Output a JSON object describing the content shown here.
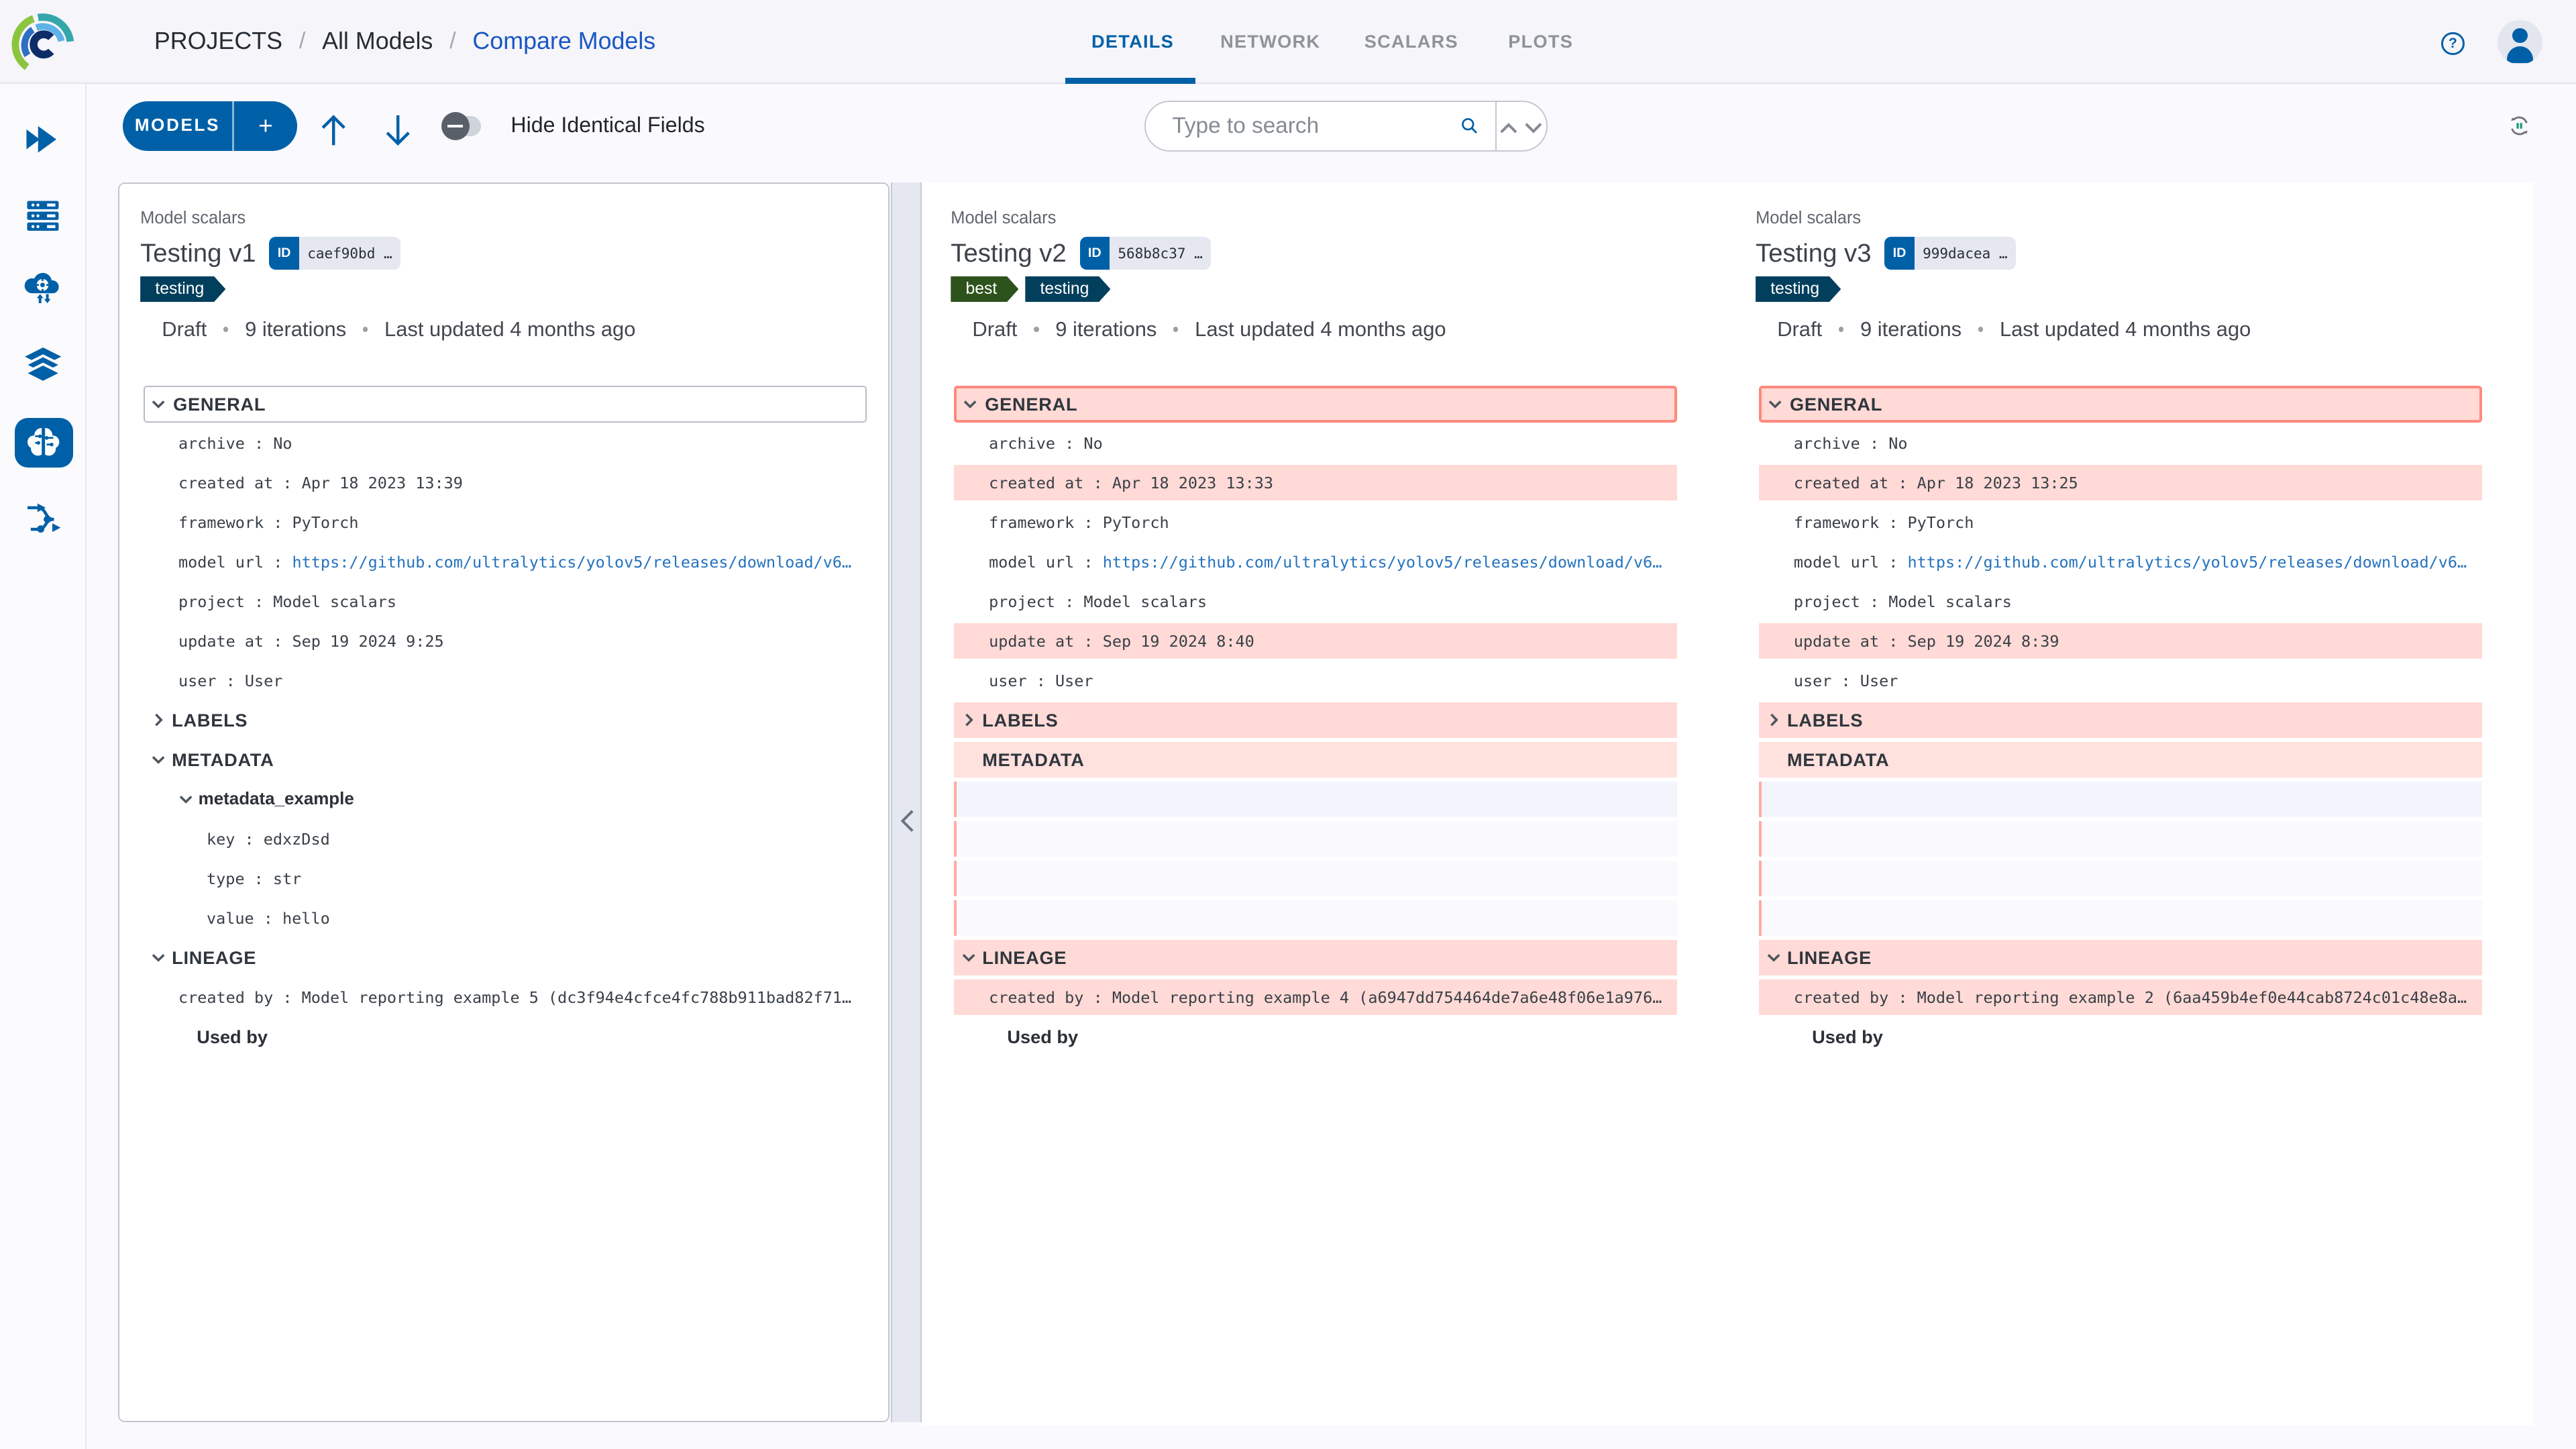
{
  "header": {
    "breadcrumbs": [
      "PROJECTS",
      "All Models",
      "Compare Models"
    ],
    "tabs": [
      {
        "label": "DETAILS",
        "active": true
      },
      {
        "label": "NETWORK",
        "active": false
      },
      {
        "label": "SCALARS",
        "active": false
      },
      {
        "label": "PLOTS",
        "active": false
      }
    ],
    "help_label": "?"
  },
  "toolbar": {
    "models_label": "MODELS",
    "add_label": "+",
    "hide_identical_label": "Hide Identical Fields",
    "search_placeholder": "Type to search"
  },
  "sidebar": {
    "items": [
      "getting-started",
      "queues",
      "workers",
      "datasets",
      "models",
      "pipelines"
    ],
    "active": "models"
  },
  "colors": {
    "brand_blue": "#0060a7",
    "diff_row": "#ffdad6",
    "diff_row_light": "#ffe1de",
    "diff_border": "#ff897d",
    "empty_row_blue": "#f3f5fd",
    "empty_row_faint": "#faf9fd",
    "tag_testing": "#023f5c",
    "tag_best": "#2e521b"
  },
  "columns": [
    {
      "project_label": "Model scalars",
      "title": "Testing v1",
      "id_badge": "ID",
      "id_value": "caef90bd",
      "id_ellipsis": " …",
      "tags": [
        {
          "label": "testing",
          "bg": "#023f5c"
        }
      ],
      "status": [
        "Draft",
        "9 iterations",
        "Last updated 4 months ago"
      ],
      "rows": [
        {
          "t": "hbox",
          "label": "GENERAL",
          "chev": "down",
          "diff": false
        },
        {
          "t": "f",
          "k": "archive",
          "v": "No"
        },
        {
          "t": "f",
          "k": "created at",
          "v": "Apr 18 2023 13:39"
        },
        {
          "t": "f",
          "k": "framework",
          "v": "PyTorch"
        },
        {
          "t": "f",
          "k": "model url",
          "v": "https://github.com/ultralytics/yolov5/releases/download/v6…",
          "link": true
        },
        {
          "t": "f",
          "k": "project",
          "v": "Model scalars"
        },
        {
          "t": "f",
          "k": "update at",
          "v": "Sep 19 2024 9:25"
        },
        {
          "t": "f",
          "k": "user",
          "v": "User"
        },
        {
          "t": "s",
          "label": "LABELS",
          "chev": "right"
        },
        {
          "t": "s",
          "label": "METADATA",
          "chev": "down"
        },
        {
          "t": "g",
          "label": "metadata_example",
          "chev": "down"
        },
        {
          "t": "f2",
          "k": "key",
          "v": "edxzDsd"
        },
        {
          "t": "f2",
          "k": "type",
          "v": "str"
        },
        {
          "t": "f2",
          "k": "value",
          "v": "hello"
        },
        {
          "t": "s",
          "label": "LINEAGE",
          "chev": "down"
        },
        {
          "t": "f",
          "k": "created by",
          "v": "Model reporting example 5 (dc3f94e4cfce4fc788b911bad82f71…"
        },
        {
          "t": "u",
          "label": "Used by"
        }
      ]
    },
    {
      "project_label": "Model scalars",
      "title": "Testing v2",
      "id_badge": "ID",
      "id_value": "568b8c37",
      "id_ellipsis": " …",
      "tags": [
        {
          "label": "best",
          "bg": "#2e521b"
        },
        {
          "label": "testing",
          "bg": "#023f5c"
        }
      ],
      "status": [
        "Draft",
        "9 iterations",
        "Last updated 4 months ago"
      ],
      "rows": [
        {
          "t": "hbox",
          "label": "GENERAL",
          "chev": "down",
          "diff": true
        },
        {
          "t": "f",
          "k": "archive",
          "v": "No"
        },
        {
          "t": "f",
          "k": "created at",
          "v": "Apr 18 2023 13:33",
          "bg": "pink"
        },
        {
          "t": "f",
          "k": "framework",
          "v": "PyTorch"
        },
        {
          "t": "f",
          "k": "model url",
          "v": "https://github.com/ultralytics/yolov5/releases/download/v6…",
          "link": true
        },
        {
          "t": "f",
          "k": "project",
          "v": "Model scalars"
        },
        {
          "t": "f",
          "k": "update at",
          "v": "Sep 19 2024 8:40",
          "bg": "pink"
        },
        {
          "t": "f",
          "k": "user",
          "v": "User"
        },
        {
          "t": "s",
          "label": "LABELS",
          "chev": "right",
          "bg": "pink"
        },
        {
          "t": "s",
          "label": "METADATA",
          "chev": null,
          "bg": "pinklight"
        },
        {
          "t": "e",
          "bg": "blue"
        },
        {
          "t": "e",
          "bg": "faint"
        },
        {
          "t": "e",
          "bg": "faint"
        },
        {
          "t": "e",
          "bg": "faint"
        },
        {
          "t": "s",
          "label": "LINEAGE",
          "chev": "down",
          "bg": "pink"
        },
        {
          "t": "f",
          "k": "created by",
          "v": "Model reporting example 4 (a6947dd754464de7a6e48f06e1a976…",
          "bg": "pink"
        },
        {
          "t": "u",
          "label": "Used by"
        }
      ]
    },
    {
      "project_label": "Model scalars",
      "title": "Testing v3",
      "id_badge": "ID",
      "id_value": "999dacea",
      "id_ellipsis": " …",
      "tags": [
        {
          "label": "testing",
          "bg": "#023f5c"
        }
      ],
      "status": [
        "Draft",
        "9 iterations",
        "Last updated 4 months ago"
      ],
      "rows": [
        {
          "t": "hbox",
          "label": "GENERAL",
          "chev": "down",
          "diff": true
        },
        {
          "t": "f",
          "k": "archive",
          "v": "No"
        },
        {
          "t": "f",
          "k": "created at",
          "v": "Apr 18 2023 13:25",
          "bg": "pink"
        },
        {
          "t": "f",
          "k": "framework",
          "v": "PyTorch"
        },
        {
          "t": "f",
          "k": "model url",
          "v": "https://github.com/ultralytics/yolov5/releases/download/v6…",
          "link": true
        },
        {
          "t": "f",
          "k": "project",
          "v": "Model scalars"
        },
        {
          "t": "f",
          "k": "update at",
          "v": "Sep 19 2024 8:39",
          "bg": "pink"
        },
        {
          "t": "f",
          "k": "user",
          "v": "User"
        },
        {
          "t": "s",
          "label": "LABELS",
          "chev": "right",
          "bg": "pink"
        },
        {
          "t": "s",
          "label": "METADATA",
          "chev": null,
          "bg": "pinklight"
        },
        {
          "t": "e",
          "bg": "blue"
        },
        {
          "t": "e",
          "bg": "faint"
        },
        {
          "t": "e",
          "bg": "faint"
        },
        {
          "t": "e",
          "bg": "faint"
        },
        {
          "t": "s",
          "label": "LINEAGE",
          "chev": "down",
          "bg": "pink"
        },
        {
          "t": "f",
          "k": "created by",
          "v": "Model reporting example 2 (6aa459b4ef0e44cab8724c01c48e8a…",
          "bg": "pink"
        },
        {
          "t": "u",
          "label": "Used by"
        }
      ]
    }
  ]
}
